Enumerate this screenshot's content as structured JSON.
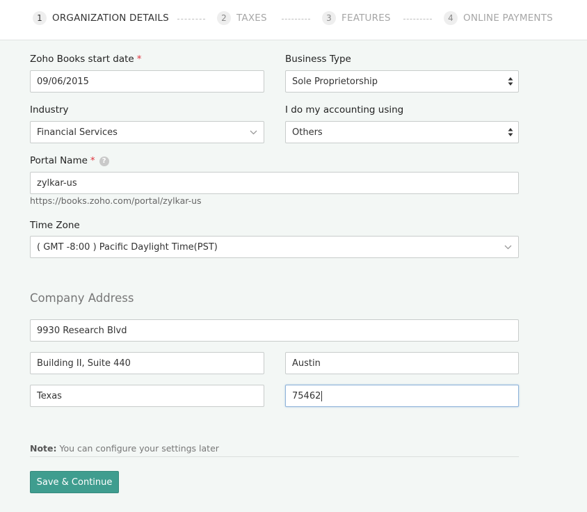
{
  "steps": [
    {
      "num": "1",
      "label": "ORGANIZATION DETAILS"
    },
    {
      "num": "2",
      "label": "TAXES"
    },
    {
      "num": "3",
      "label": "FEATURES"
    },
    {
      "num": "4",
      "label": "ONLINE PAYMENTS"
    }
  ],
  "form": {
    "start_date": {
      "label": "Zoho Books start date",
      "required": "*",
      "value": "09/06/2015"
    },
    "business_type": {
      "label": "Business Type",
      "value": "Sole Proprietorship"
    },
    "industry": {
      "label": "Industry",
      "value": "Financial Services"
    },
    "accounting": {
      "label": "I do my accounting using",
      "value": "Others"
    },
    "portal": {
      "label": "Portal Name",
      "required": "*",
      "help": "?",
      "value": "zylkar-us",
      "hint": "https://books.zoho.com/portal/zylkar-us"
    },
    "timezone": {
      "label": "Time Zone",
      "value": "( GMT -8:00 ) Pacific Daylight Time(PST)"
    }
  },
  "address": {
    "title": "Company Address",
    "street1": "9930 Research Blvd",
    "street2": "Building II, Suite 440",
    "city": "Austin",
    "state": "Texas",
    "zip": "75462"
  },
  "note": {
    "prefix": "Note:",
    "text": " You can configure your settings later"
  },
  "save_label": "Save & Continue",
  "colors": {
    "accent": "#3f9d8f",
    "required": "#e0343e",
    "background": "#f3f7f5"
  }
}
